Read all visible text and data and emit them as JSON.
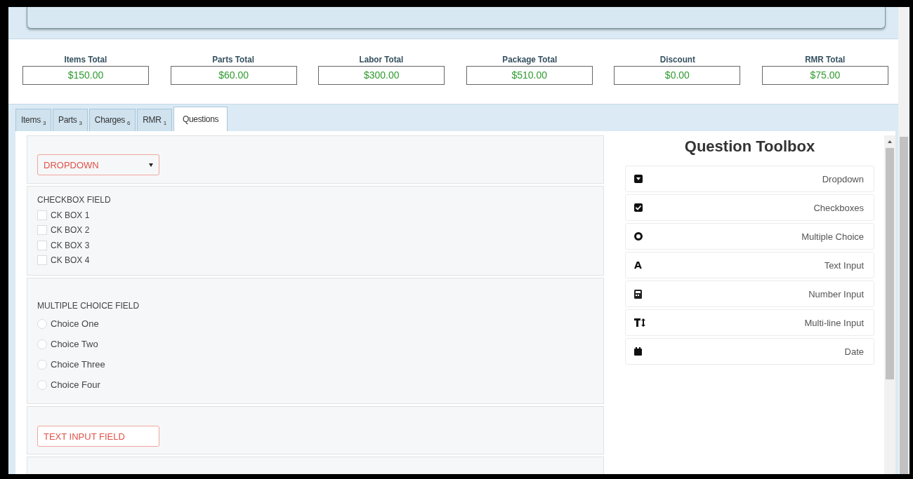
{
  "totals": [
    {
      "label": "Items Total",
      "value": "$150.00"
    },
    {
      "label": "Parts Total",
      "value": "$60.00"
    },
    {
      "label": "Labor Total",
      "value": "$300.00"
    },
    {
      "label": "Package Total",
      "value": "$510.00"
    },
    {
      "label": "Discount",
      "value": "$0.00"
    },
    {
      "label": "RMR Total",
      "value": "$75.00"
    }
  ],
  "tabs": [
    {
      "label": "Items",
      "count": "3",
      "selected": false
    },
    {
      "label": "Parts",
      "count": "3",
      "selected": false
    },
    {
      "label": "Charges",
      "count": "6",
      "selected": false
    },
    {
      "label": "RMR",
      "count": "1",
      "selected": false
    },
    {
      "label": "Questions",
      "selected": true
    }
  ],
  "questions": [
    {
      "kind": "dropdown",
      "placeholder": "DROPDOWN"
    },
    {
      "kind": "checkbox",
      "label": "CHECKBOX FIELD",
      "options": [
        {
          "label": "CK BOX 1",
          "checked": false
        },
        {
          "label": "CK BOX 2",
          "checked": false
        },
        {
          "label": "CK BOX 3",
          "checked": false
        },
        {
          "label": "CK BOX 4",
          "checked": false
        }
      ]
    },
    {
      "kind": "radio",
      "label": "MULTIPLE CHOICE FIELD",
      "options": [
        {
          "label": "Choice One",
          "selected": false
        },
        {
          "label": "Choice Two",
          "selected": false
        },
        {
          "label": "Choice Three",
          "selected": false
        },
        {
          "label": "Choice Four",
          "selected": false
        }
      ]
    },
    {
      "kind": "text",
      "placeholder": "TEXT INPUT FIELD"
    },
    {
      "kind": "empty"
    }
  ],
  "toolbox": {
    "title": "Question Toolbox",
    "items": [
      {
        "kind": "dropdown",
        "label": "Dropdown"
      },
      {
        "kind": "checkbox",
        "label": "Checkboxes"
      },
      {
        "kind": "radio",
        "label": "Multiple Choice"
      },
      {
        "kind": "text",
        "glyph": "A",
        "label": "Text Input"
      },
      {
        "kind": "number",
        "label": "Number Input"
      },
      {
        "kind": "multiline",
        "label": "Multi-line Input"
      },
      {
        "kind": "date",
        "label": "Date"
      }
    ]
  }
}
